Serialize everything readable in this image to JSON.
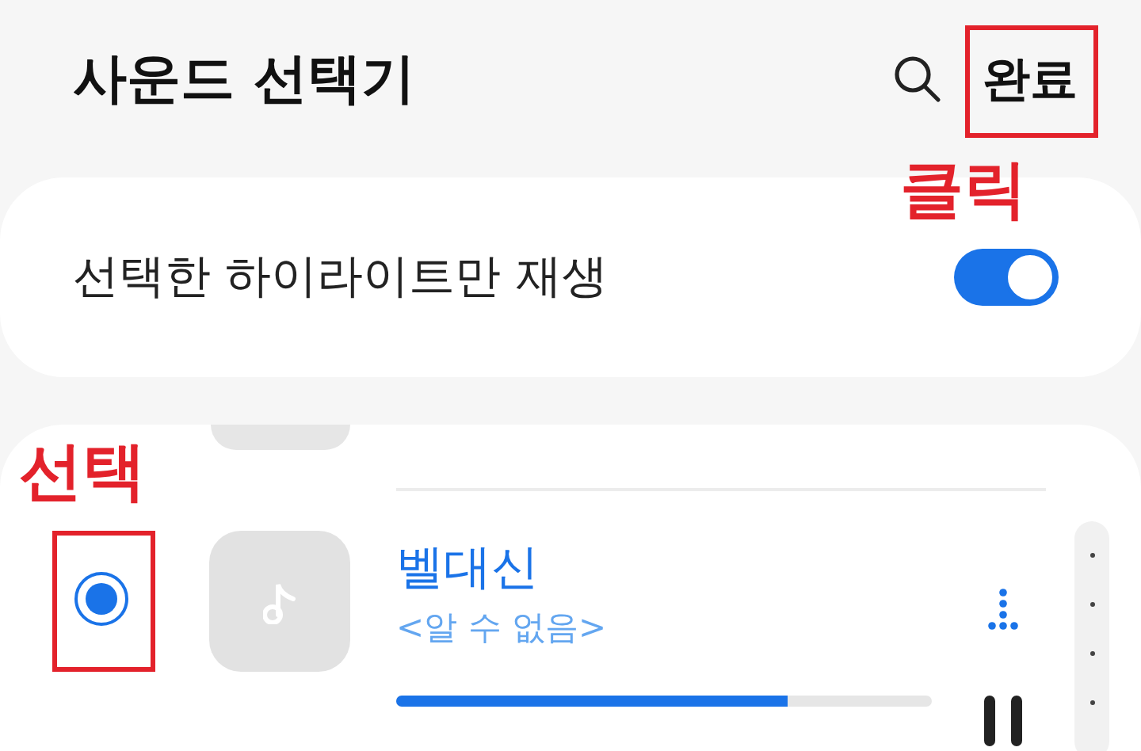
{
  "header": {
    "title": "사운드 선택기",
    "done_button": "완료"
  },
  "annotations": [
    {
      "text": "클릭"
    },
    {
      "text": "선택"
    }
  ],
  "highlight_setting": {
    "label": "선택한 하이라이트만 재생",
    "on": true
  },
  "sounds": [
    {
      "title": "벨대신",
      "artist": "<알 수 없음>",
      "selected": true,
      "level": 0.73,
      "playing": true
    }
  ]
}
